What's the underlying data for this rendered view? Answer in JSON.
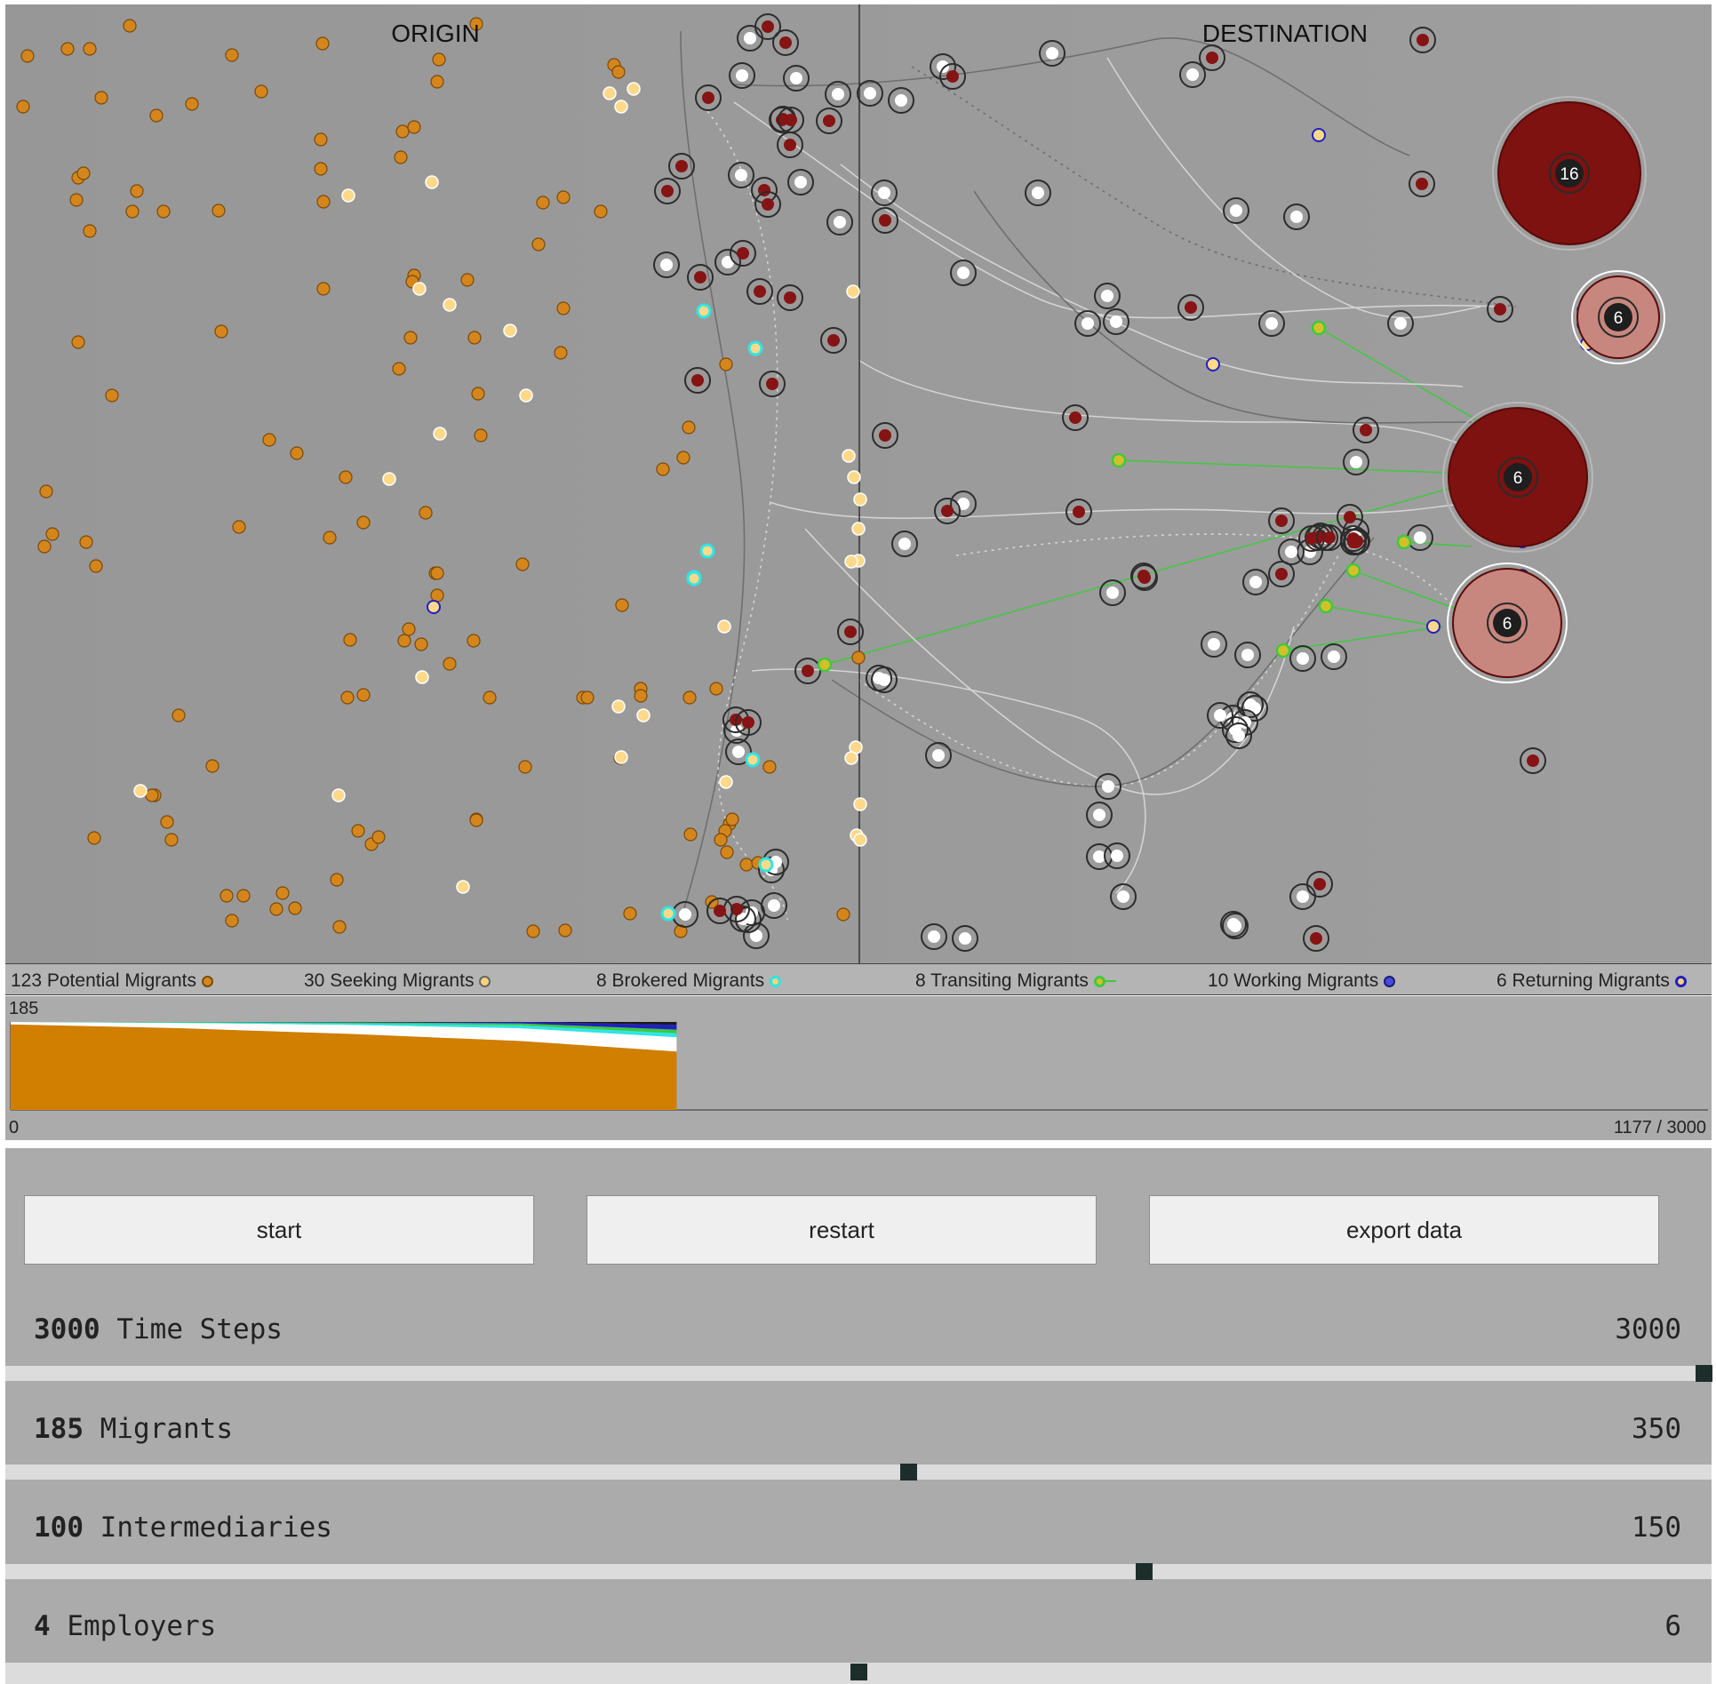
{
  "sim": {
    "origin_label": "ORIGIN",
    "destination_label": "DESTINATION",
    "employer_counts": [
      "16",
      "6",
      "6",
      "6"
    ]
  },
  "legend": [
    {
      "label": "123 Potential Migrants",
      "color": "#d28a1f",
      "ring": "#7a4a0a",
      "icon": "filled-circle"
    },
    {
      "label": "30 Seeking Migrants",
      "color": "#ffd27a",
      "ring": "#ffffff",
      "icon": "filled-circle"
    },
    {
      "label": "8 Brokered Migrants",
      "color": "#d28a1f",
      "ring": "#2ee6e6",
      "icon": "ring"
    },
    {
      "label": "8 Transiting Migrants",
      "color": "#d2c02a",
      "ring": "#3ec93e",
      "icon": "ring-tail"
    },
    {
      "label": "10 Working Migrants",
      "color": "#4a4ad8",
      "ring": "#1a1a7a",
      "icon": "filled-circle"
    },
    {
      "label": "6 Returning Migrants",
      "color": "#ffffff",
      "ring": "#2020c0",
      "icon": "ring"
    }
  ],
  "chart_data": {
    "type": "area",
    "ymax_label": "185",
    "ymin_label": "0",
    "progress_label": "1177 / 3000",
    "xlim": [
      0,
      3000
    ],
    "ylim": [
      0,
      185
    ],
    "x": [
      0,
      300,
      600,
      900,
      1177
    ],
    "series": [
      {
        "name": "Potential",
        "color": "#d07f00",
        "values": [
          180,
          172,
          160,
          145,
          123
        ]
      },
      {
        "name": "Seeking",
        "color": "#ffffff",
        "values": [
          5,
          11,
          19,
          27,
          30
        ]
      },
      {
        "name": "Brokered",
        "color": "#2ee6e6",
        "values": [
          0,
          1,
          3,
          6,
          8
        ]
      },
      {
        "name": "Transiting",
        "color": "#3ec93e",
        "values": [
          0,
          1,
          2,
          4,
          8
        ]
      },
      {
        "name": "Working",
        "color": "#2020c0",
        "values": [
          0,
          0,
          1,
          3,
          10
        ]
      },
      {
        "name": "Returning",
        "color": "#1a1a1a",
        "values": [
          0,
          0,
          0,
          0,
          6
        ]
      }
    ]
  },
  "controls": {
    "buttons": {
      "start": "start",
      "restart": "restart",
      "export": "export data"
    },
    "params": [
      {
        "value": "3000",
        "name": "Time Steps",
        "max": "3000",
        "fraction": 1.0
      },
      {
        "value": "185",
        "name": "Migrants",
        "max": "350",
        "fraction": 0.529
      },
      {
        "value": "100",
        "name": "Intermediaries",
        "max": "150",
        "fraction": 0.667
      },
      {
        "value": "4",
        "name": "Employers",
        "max": "6",
        "fraction": 0.5
      }
    ]
  }
}
